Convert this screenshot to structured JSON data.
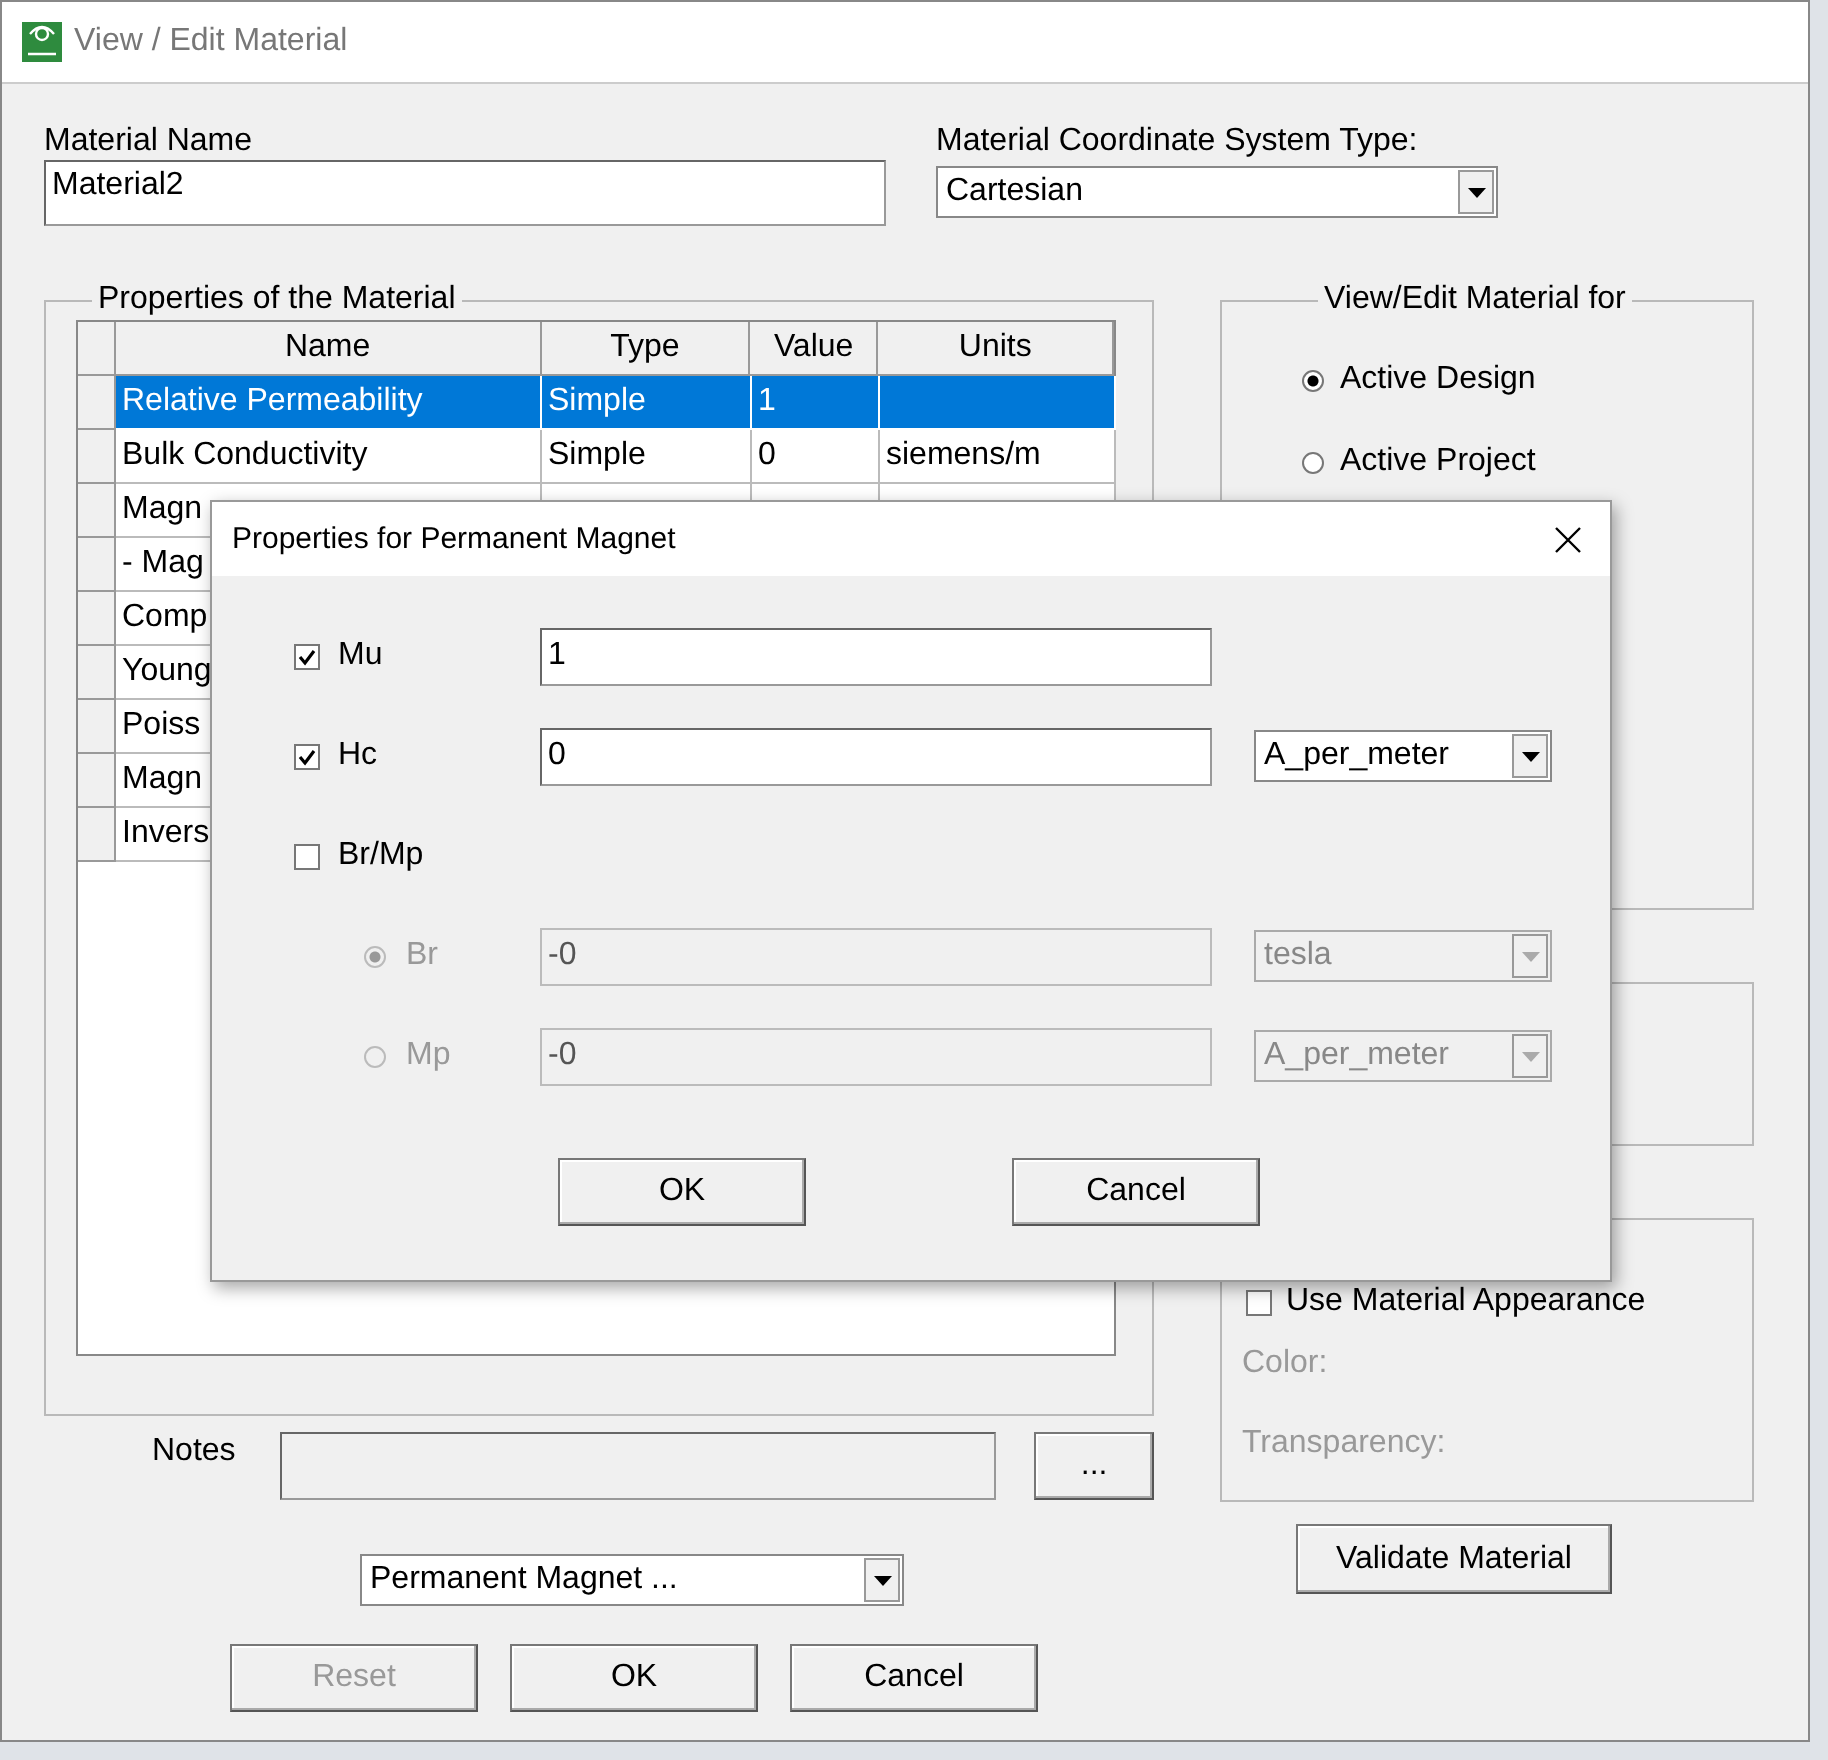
{
  "window": {
    "title": "View / Edit Material"
  },
  "material_name": {
    "label": "Material Name",
    "value": "Material2"
  },
  "coordinate_system": {
    "label": "Material Coordinate System Type:",
    "value": "Cartesian"
  },
  "properties": {
    "title": "Properties of the Material",
    "columns": [
      "Name",
      "Type",
      "Value",
      "Units"
    ],
    "rows": [
      {
        "cells": [
          "Relative Permeability",
          "Simple",
          "1"
        ],
        "selected": true
      },
      {
        "cells": [
          "Bulk Conductivity",
          "Simple",
          "0",
          "siemens/m"
        ],
        "selected": false
      },
      {
        "cells": [
          "Magn"
        ],
        "selected": false
      },
      {
        "cells": [
          "-  Mag"
        ],
        "selected": false
      },
      {
        "cells": [
          "Comp"
        ],
        "selected": false
      },
      {
        "cells": [
          "Young"
        ],
        "selected": false
      },
      {
        "cells": [
          "Poiss"
        ],
        "selected": false
      },
      {
        "cells": [
          "Magn"
        ],
        "selected": false
      },
      {
        "cells": [
          "Invers"
        ],
        "selected": false
      }
    ]
  },
  "notes": {
    "label": "Notes",
    "button": "..."
  },
  "material_type": {
    "value": "Permanent Magnet ..."
  },
  "buttons": [
    {
      "label": "Reset",
      "disabled": true
    },
    {
      "label": "OK",
      "disabled": false
    },
    {
      "label": "Cancel",
      "disabled": false
    }
  ],
  "view_edit_for": {
    "title": "View/Edit Material for",
    "options": [
      {
        "label": "Active Design",
        "selected": true
      },
      {
        "label": "Active Project",
        "selected": false
      }
    ]
  },
  "appearance": {
    "checkbox": {
      "label": "Use Material Appearance",
      "checked": false
    },
    "color_label": "Color:",
    "transparency_label": "Transparency:"
  },
  "validate_button": "Validate Material",
  "dialog": {
    "title": "Properties for Permanent Magnet",
    "rows": [
      {
        "kind": "checkbox",
        "label": "Mu",
        "checked": true,
        "value": "1"
      },
      {
        "kind": "checkbox",
        "label": "Hc",
        "checked": true,
        "value": "0",
        "unit": "A_per_meter"
      },
      {
        "kind": "checkbox",
        "label": "Br/Mp",
        "checked": false
      },
      {
        "kind": "radio",
        "label": "Br",
        "selected": true,
        "disabled": true,
        "value": "-0",
        "unit": "tesla"
      },
      {
        "kind": "radio",
        "label": "Mp",
        "selected": false,
        "disabled": true,
        "value": "-0",
        "unit": "A_per_meter"
      }
    ],
    "buttons": [
      "OK",
      "Cancel"
    ]
  }
}
